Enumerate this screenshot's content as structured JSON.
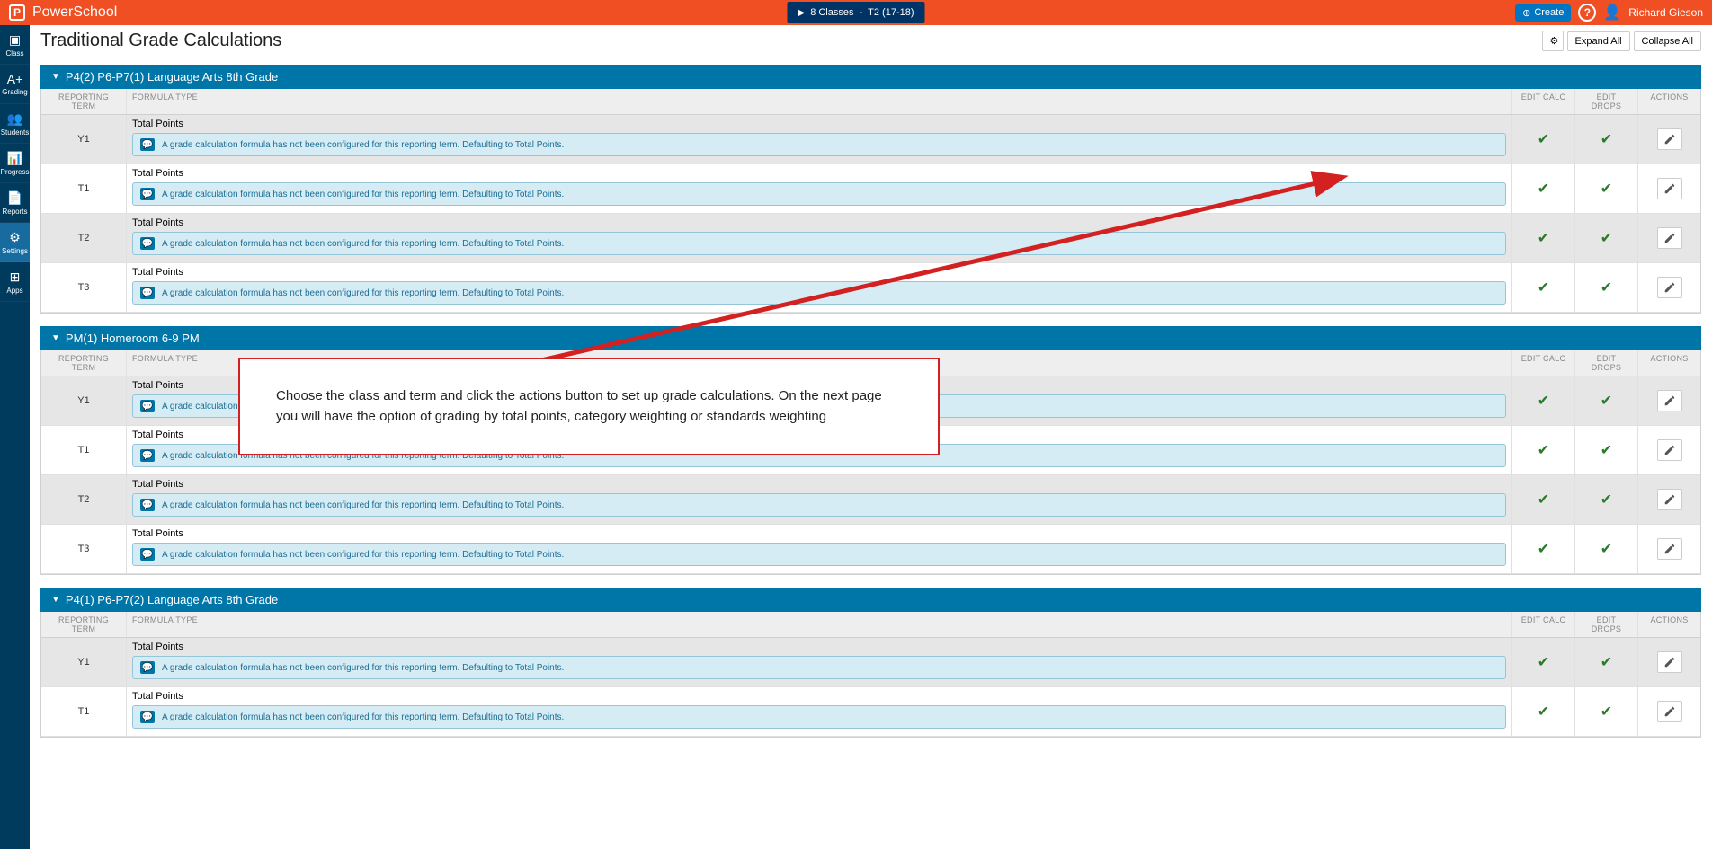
{
  "brand": "PowerSchool",
  "class_selector": {
    "count": "8 Classes",
    "term": "T2  (17-18)"
  },
  "create_label": "Create",
  "username": "Richard Gieson",
  "sidebar": {
    "items": [
      {
        "label": "Class",
        "icon": "▣"
      },
      {
        "label": "Grading",
        "icon": "A+"
      },
      {
        "label": "Students",
        "icon": "👥"
      },
      {
        "label": "Progress",
        "icon": "📊"
      },
      {
        "label": "Reports",
        "icon": "📄"
      },
      {
        "label": "Settings",
        "icon": "⚙"
      },
      {
        "label": "Apps",
        "icon": "⊞"
      }
    ],
    "active_index": 5
  },
  "page_title": "Traditional Grade Calculations",
  "buttons": {
    "expand": "Expand All",
    "collapse": "Collapse All"
  },
  "columns": {
    "reporting_term": "REPORTING TERM",
    "formula_type": "FORMULA TYPE",
    "edit_calc": "EDIT CALC",
    "edit_drops": "EDIT DROPS",
    "actions": "ACTIONS"
  },
  "info_message": "A grade calculation formula has not been configured for this reporting term. Defaulting to Total Points.",
  "formula_label": "Total Points",
  "annotation_text": "Choose the class and term and click the actions button to set up grade calculations.  On the next page you will have the option of grading by total points, category weighting or standards weighting",
  "sections": [
    {
      "title": "P4(2) P6-P7(1) Language Arts 8th Grade",
      "terms": [
        "Y1",
        "T1",
        "T2",
        "T3"
      ]
    },
    {
      "title": "PM(1) Homeroom 6-9 PM",
      "terms": [
        "Y1",
        "T1",
        "T2",
        "T3"
      ]
    },
    {
      "title": "P4(1) P6-P7(2) Language Arts 8th Grade",
      "terms": [
        "Y1",
        "T1"
      ]
    }
  ]
}
